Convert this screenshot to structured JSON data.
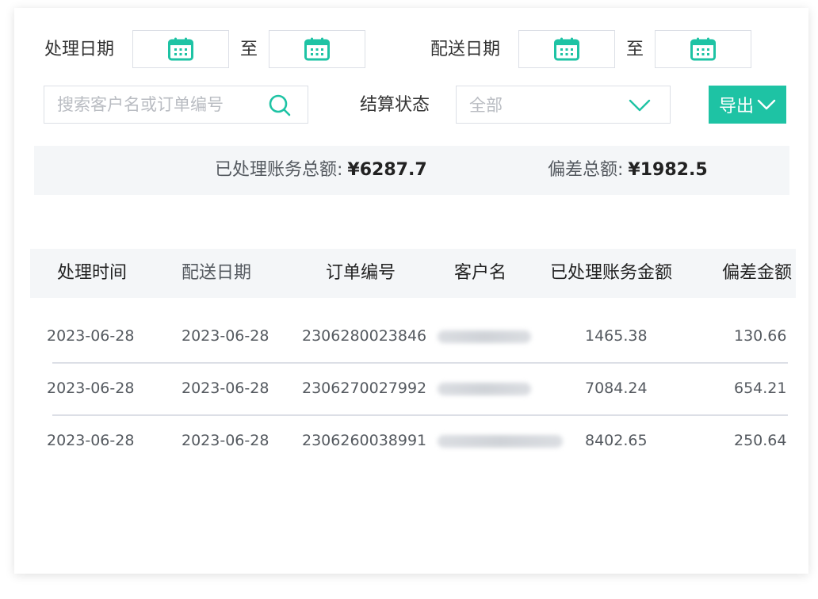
{
  "filters": {
    "process_date_label": "处理日期",
    "to_label_1": "至",
    "delivery_date_label": "配送日期",
    "to_label_2": "至",
    "search_placeholder": "搜索客户名或订单编号",
    "settle_status_label": "结算状态",
    "settle_status_value": "全部",
    "export_label": "导出"
  },
  "summary": {
    "processed_total_label": "已处理账务总额:",
    "processed_total_value": "¥6287.7",
    "deviation_total_label": "偏差总额:",
    "deviation_total_value": "¥1982.5"
  },
  "table": {
    "headers": [
      "处理时间",
      "配送日期",
      "订单编号",
      "客户名",
      "已处理账务金额",
      "偏差金额"
    ],
    "rows": [
      {
        "process_time": "2023-06-28",
        "delivery_date": "2023-06-28",
        "order_no": "2306280023846",
        "amount": "1465.38",
        "deviation": "130.66"
      },
      {
        "process_time": "2023-06-28",
        "delivery_date": "2023-06-28",
        "order_no": "2306270027992",
        "amount": "7084.24",
        "deviation": "654.21"
      },
      {
        "process_time": "2023-06-28",
        "delivery_date": "2023-06-28",
        "order_no": "2306260038991",
        "amount": "8402.65",
        "deviation": "250.64"
      }
    ]
  },
  "colors": {
    "accent": "#1ec3a4",
    "header_bg": "#f4f6f8",
    "border": "#dcdfe6"
  },
  "icons": {
    "calendar": "calendar-icon",
    "search": "search-icon",
    "dropdown": "chevron-down-icon"
  }
}
